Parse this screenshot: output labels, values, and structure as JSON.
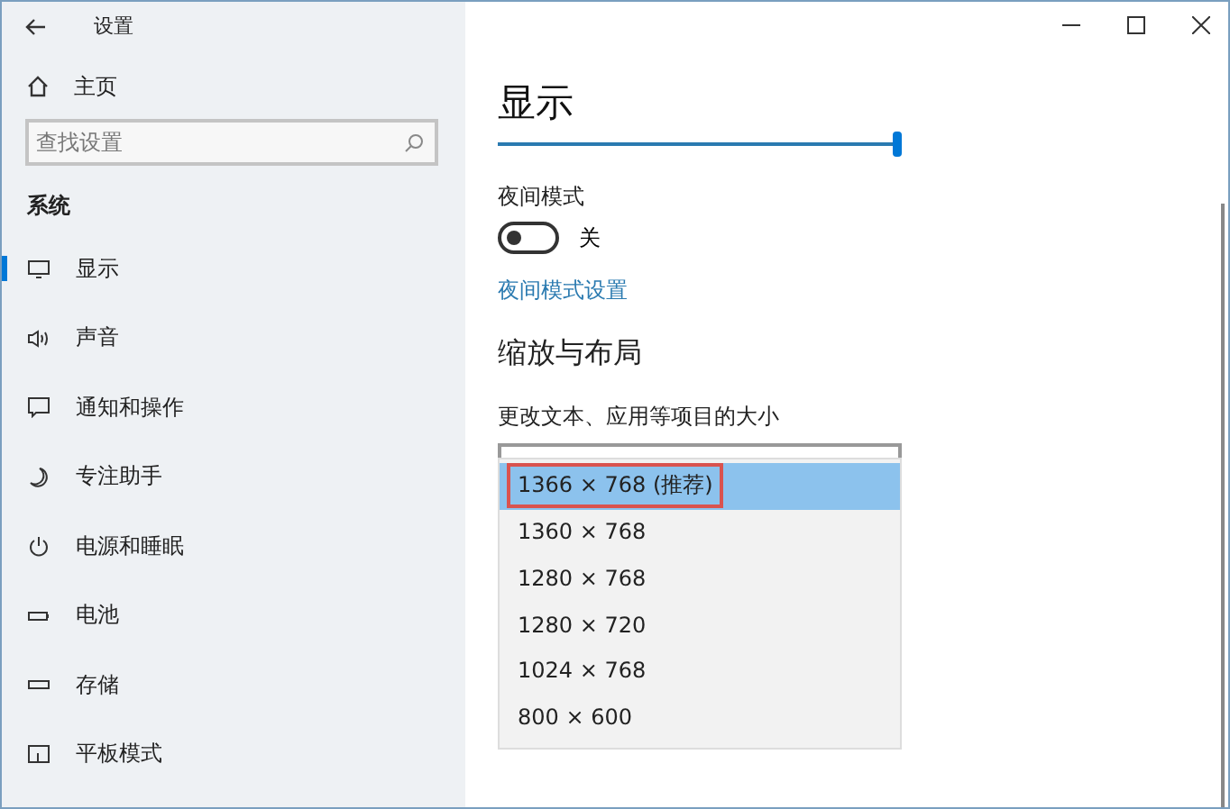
{
  "window": {
    "title": "设置"
  },
  "sidebar": {
    "home": "主页",
    "search": {
      "placeholder": "查找设置"
    },
    "section": "系统",
    "items": [
      {
        "kind": "display",
        "label": "显示",
        "selected": true
      },
      {
        "kind": "sound",
        "label": "声音",
        "selected": false
      },
      {
        "kind": "notify",
        "label": "通知和操作",
        "selected": false
      },
      {
        "kind": "focus",
        "label": "专注助手",
        "selected": false
      },
      {
        "kind": "power",
        "label": "电源和睡眠",
        "selected": false
      },
      {
        "kind": "battery",
        "label": "电池",
        "selected": false
      },
      {
        "kind": "storage",
        "label": "存储",
        "selected": false
      },
      {
        "kind": "tablet",
        "label": "平板模式",
        "selected": false
      }
    ]
  },
  "content": {
    "heading": "显示",
    "slider": {
      "level": 1.0
    },
    "night_mode": {
      "label": "夜间模式",
      "on": false,
      "state_text": "关"
    },
    "night_link": "夜间模式设置",
    "section": "缩放与布局",
    "resolution_label": "更改文本、应用等项目的大小",
    "options": [
      {
        "label": "1366 × 768 (推荐)",
        "selected": true,
        "outlined": true
      },
      {
        "label": "1360 × 768",
        "selected": false,
        "outlined": false
      },
      {
        "label": "1280 × 768",
        "selected": false,
        "outlined": false
      },
      {
        "label": "1280 × 720",
        "selected": false,
        "outlined": false
      },
      {
        "label": "1024 × 768",
        "selected": false,
        "outlined": false
      },
      {
        "label": "800 × 600",
        "selected": false,
        "outlined": false
      }
    ]
  }
}
